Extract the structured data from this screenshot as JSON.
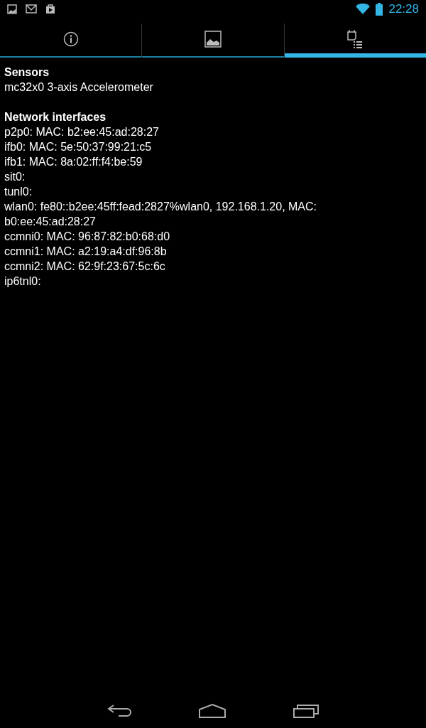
{
  "status_bar": {
    "time": "22:28"
  },
  "tabs": [
    {
      "kind": "info",
      "selected": false
    },
    {
      "kind": "image",
      "selected": false
    },
    {
      "kind": "list",
      "selected": true
    }
  ],
  "sections": [
    {
      "heading": "Sensors",
      "lines": [
        "mc32x0 3-axis Accelerometer"
      ]
    },
    {
      "heading": "Network interfaces",
      "lines": [
        "p2p0: MAC: b2:ee:45:ad:28:27",
        "ifb0: MAC: 5e:50:37:99:21:c5",
        "ifb1: MAC: 8a:02:ff:f4:be:59",
        "sit0:",
        "tunl0:",
        "wlan0: fe80::b2ee:45ff:fead:2827%wlan0, 192.168.1.20, MAC: b0:ee:45:ad:28:27",
        "ccmni0: MAC: 96:87:82:b0:68:d0",
        "ccmni1: MAC: a2:19:a4:df:96:8b",
        "ccmni2: MAC: 62:9f:23:67:5c:6c",
        "ip6tnl0:"
      ]
    }
  ]
}
